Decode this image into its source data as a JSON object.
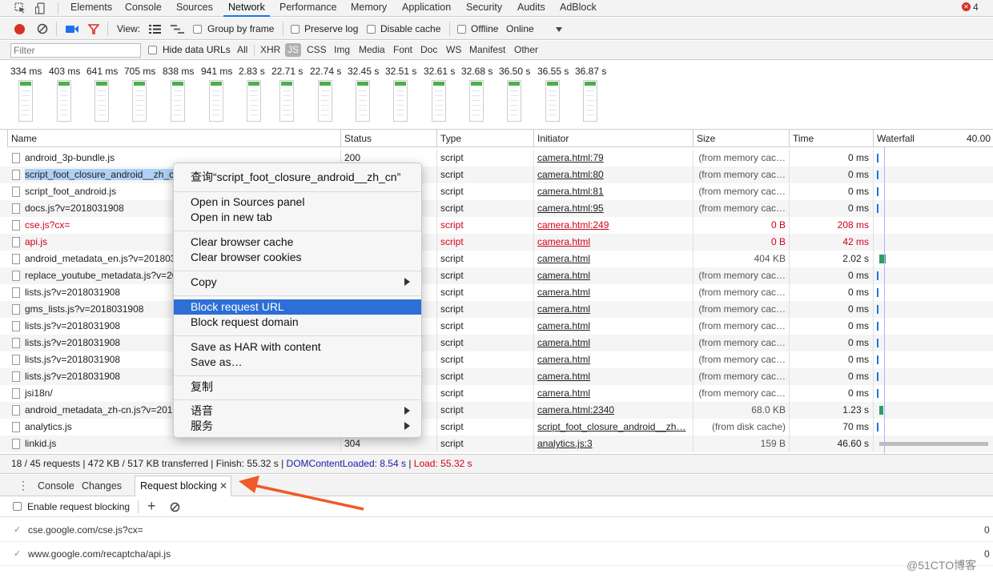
{
  "tabs": [
    {
      "label": "Elements",
      "active": false
    },
    {
      "label": "Console",
      "active": false
    },
    {
      "label": "Sources",
      "active": false
    },
    {
      "label": "Network",
      "active": true
    },
    {
      "label": "Performance",
      "active": false
    },
    {
      "label": "Memory",
      "active": false
    },
    {
      "label": "Application",
      "active": false
    },
    {
      "label": "Security",
      "active": false
    },
    {
      "label": "Audits",
      "active": false
    },
    {
      "label": "AdBlock",
      "active": false
    }
  ],
  "error_count": "4",
  "toolbar": {
    "view_label": "View:",
    "group_by_frame": "Group by frame",
    "preserve_log": "Preserve log",
    "disable_cache": "Disable cache",
    "offline": "Offline",
    "throttle": "Online"
  },
  "filter": {
    "placeholder": "Filter",
    "hide_data_urls": "Hide data URLs",
    "types": [
      "All",
      "XHR",
      "JS",
      "CSS",
      "Img",
      "Media",
      "Font",
      "Doc",
      "WS",
      "Manifest",
      "Other"
    ],
    "active_type": "JS"
  },
  "filmstrip_times": [
    "334 ms",
    "403 ms",
    "641 ms",
    "705 ms",
    "838 ms",
    "941 ms",
    "2.83 s",
    "22.71 s",
    "22.74 s",
    "32.45 s",
    "32.51 s",
    "32.61 s",
    "32.68 s",
    "36.50 s",
    "36.55 s",
    "36.87 s"
  ],
  "columns": {
    "name": "Name",
    "status": "Status",
    "type": "Type",
    "initiator": "Initiator",
    "size": "Size",
    "time": "Time",
    "waterfall": "Waterfall",
    "waterfall_scale": "40.00"
  },
  "rows": [
    {
      "name": "android_3p-bundle.js",
      "status": "200",
      "type": "script",
      "initiator": "camera.html:79",
      "size": "(from memory cac…",
      "time": "0 ms"
    },
    {
      "name": "script_foot_closure_android__zh_cn.js",
      "status": "",
      "type": "script",
      "initiator": "camera.html:80",
      "size": "(from memory cac…",
      "time": "0 ms"
    },
    {
      "name": "script_foot_android.js",
      "status": "",
      "type": "script",
      "initiator": "camera.html:81",
      "size": "(from memory cac…",
      "time": "0 ms"
    },
    {
      "name": "docs.js?v=2018031908",
      "status": "",
      "type": "script",
      "initiator": "camera.html:95",
      "size": "(from memory cac…",
      "time": "0 ms"
    },
    {
      "name": "cse.js?cx=",
      "status": "",
      "type": "script",
      "initiator": "camera.html:249",
      "size": "0 B",
      "time": "208 ms"
    },
    {
      "name": "api.js",
      "status": "",
      "type": "script",
      "initiator": "camera.html",
      "size": "0 B",
      "time": "42 ms"
    },
    {
      "name": "android_metadata_en.js?v=2018031908",
      "status": "",
      "type": "script",
      "initiator": "camera.html",
      "size": "404 KB",
      "time": "2.02 s"
    },
    {
      "name": "replace_youtube_metadata.js?v=2018031908",
      "status": "",
      "type": "script",
      "initiator": "camera.html",
      "size": "(from memory cac…",
      "time": "0 ms"
    },
    {
      "name": "lists.js?v=2018031908",
      "status": "",
      "type": "script",
      "initiator": "camera.html",
      "size": "(from memory cac…",
      "time": "0 ms"
    },
    {
      "name": "gms_lists.js?v=2018031908",
      "status": "",
      "type": "script",
      "initiator": "camera.html",
      "size": "(from memory cac…",
      "time": "0 ms"
    },
    {
      "name": "lists.js?v=2018031908",
      "status": "",
      "type": "script",
      "initiator": "camera.html",
      "size": "(from memory cac…",
      "time": "0 ms"
    },
    {
      "name": "lists.js?v=2018031908",
      "status": "",
      "type": "script",
      "initiator": "camera.html",
      "size": "(from memory cac…",
      "time": "0 ms"
    },
    {
      "name": "lists.js?v=2018031908",
      "status": "",
      "type": "script",
      "initiator": "camera.html",
      "size": "(from memory cac…",
      "time": "0 ms"
    },
    {
      "name": "lists.js?v=2018031908",
      "status": "",
      "type": "script",
      "initiator": "camera.html",
      "size": "(from memory cac…",
      "time": "0 ms"
    },
    {
      "name": "jsi18n/",
      "status": "",
      "type": "script",
      "initiator": "camera.html",
      "size": "(from memory cac…",
      "time": "0 ms"
    },
    {
      "name": "android_metadata_zh-cn.js?v=2018031908",
      "status": "",
      "type": "script",
      "initiator": "camera.html:2340",
      "size": "68.0 KB",
      "time": "1.23 s"
    },
    {
      "name": "analytics.js",
      "status": "",
      "type": "script",
      "initiator": "script_foot_closure_android__zh…",
      "size": "(from disk cache)",
      "time": "70 ms"
    },
    {
      "name": "linkid.js",
      "status": "304",
      "type": "script",
      "initiator": "analytics.js:3",
      "size": "159 B",
      "time": "46.60 s"
    }
  ],
  "status_line": {
    "summary": "18 / 45 requests | 472 KB / 517 KB transferred | Finish: 55.32 s | ",
    "dcl": "DOMContentLoaded: 8.54 s",
    "sep": " | ",
    "load": "Load: 55.32 s"
  },
  "drawer": {
    "tabs": [
      "Console",
      "Changes",
      "Request blocking"
    ],
    "enable_label": "Enable request blocking",
    "patterns": [
      {
        "url": "cse.google.com/cse.js?cx=",
        "count": "0"
      },
      {
        "url": "www.google.com/recaptcha/api.js",
        "count": "0"
      }
    ]
  },
  "context_menu": {
    "title": "查询“script_foot_closure_android__zh_cn”",
    "open_sources": "Open in Sources panel",
    "open_tab": "Open in new tab",
    "clear_cache": "Clear browser cache",
    "clear_cookies": "Clear browser cookies",
    "copy": "Copy",
    "block_url": "Block request URL",
    "block_domain": "Block request domain",
    "save_har": "Save as HAR with content",
    "save_as": "Save as…",
    "copy_cn": "复制",
    "speech": "语音",
    "services": "服务"
  },
  "watermark": "@51CTO博客",
  "colors": {
    "accent": "#1a73e8",
    "error": "#d0021b",
    "dcl": "#1a1aa6",
    "highlight": "#2e6fd6",
    "record": "#d93025"
  }
}
